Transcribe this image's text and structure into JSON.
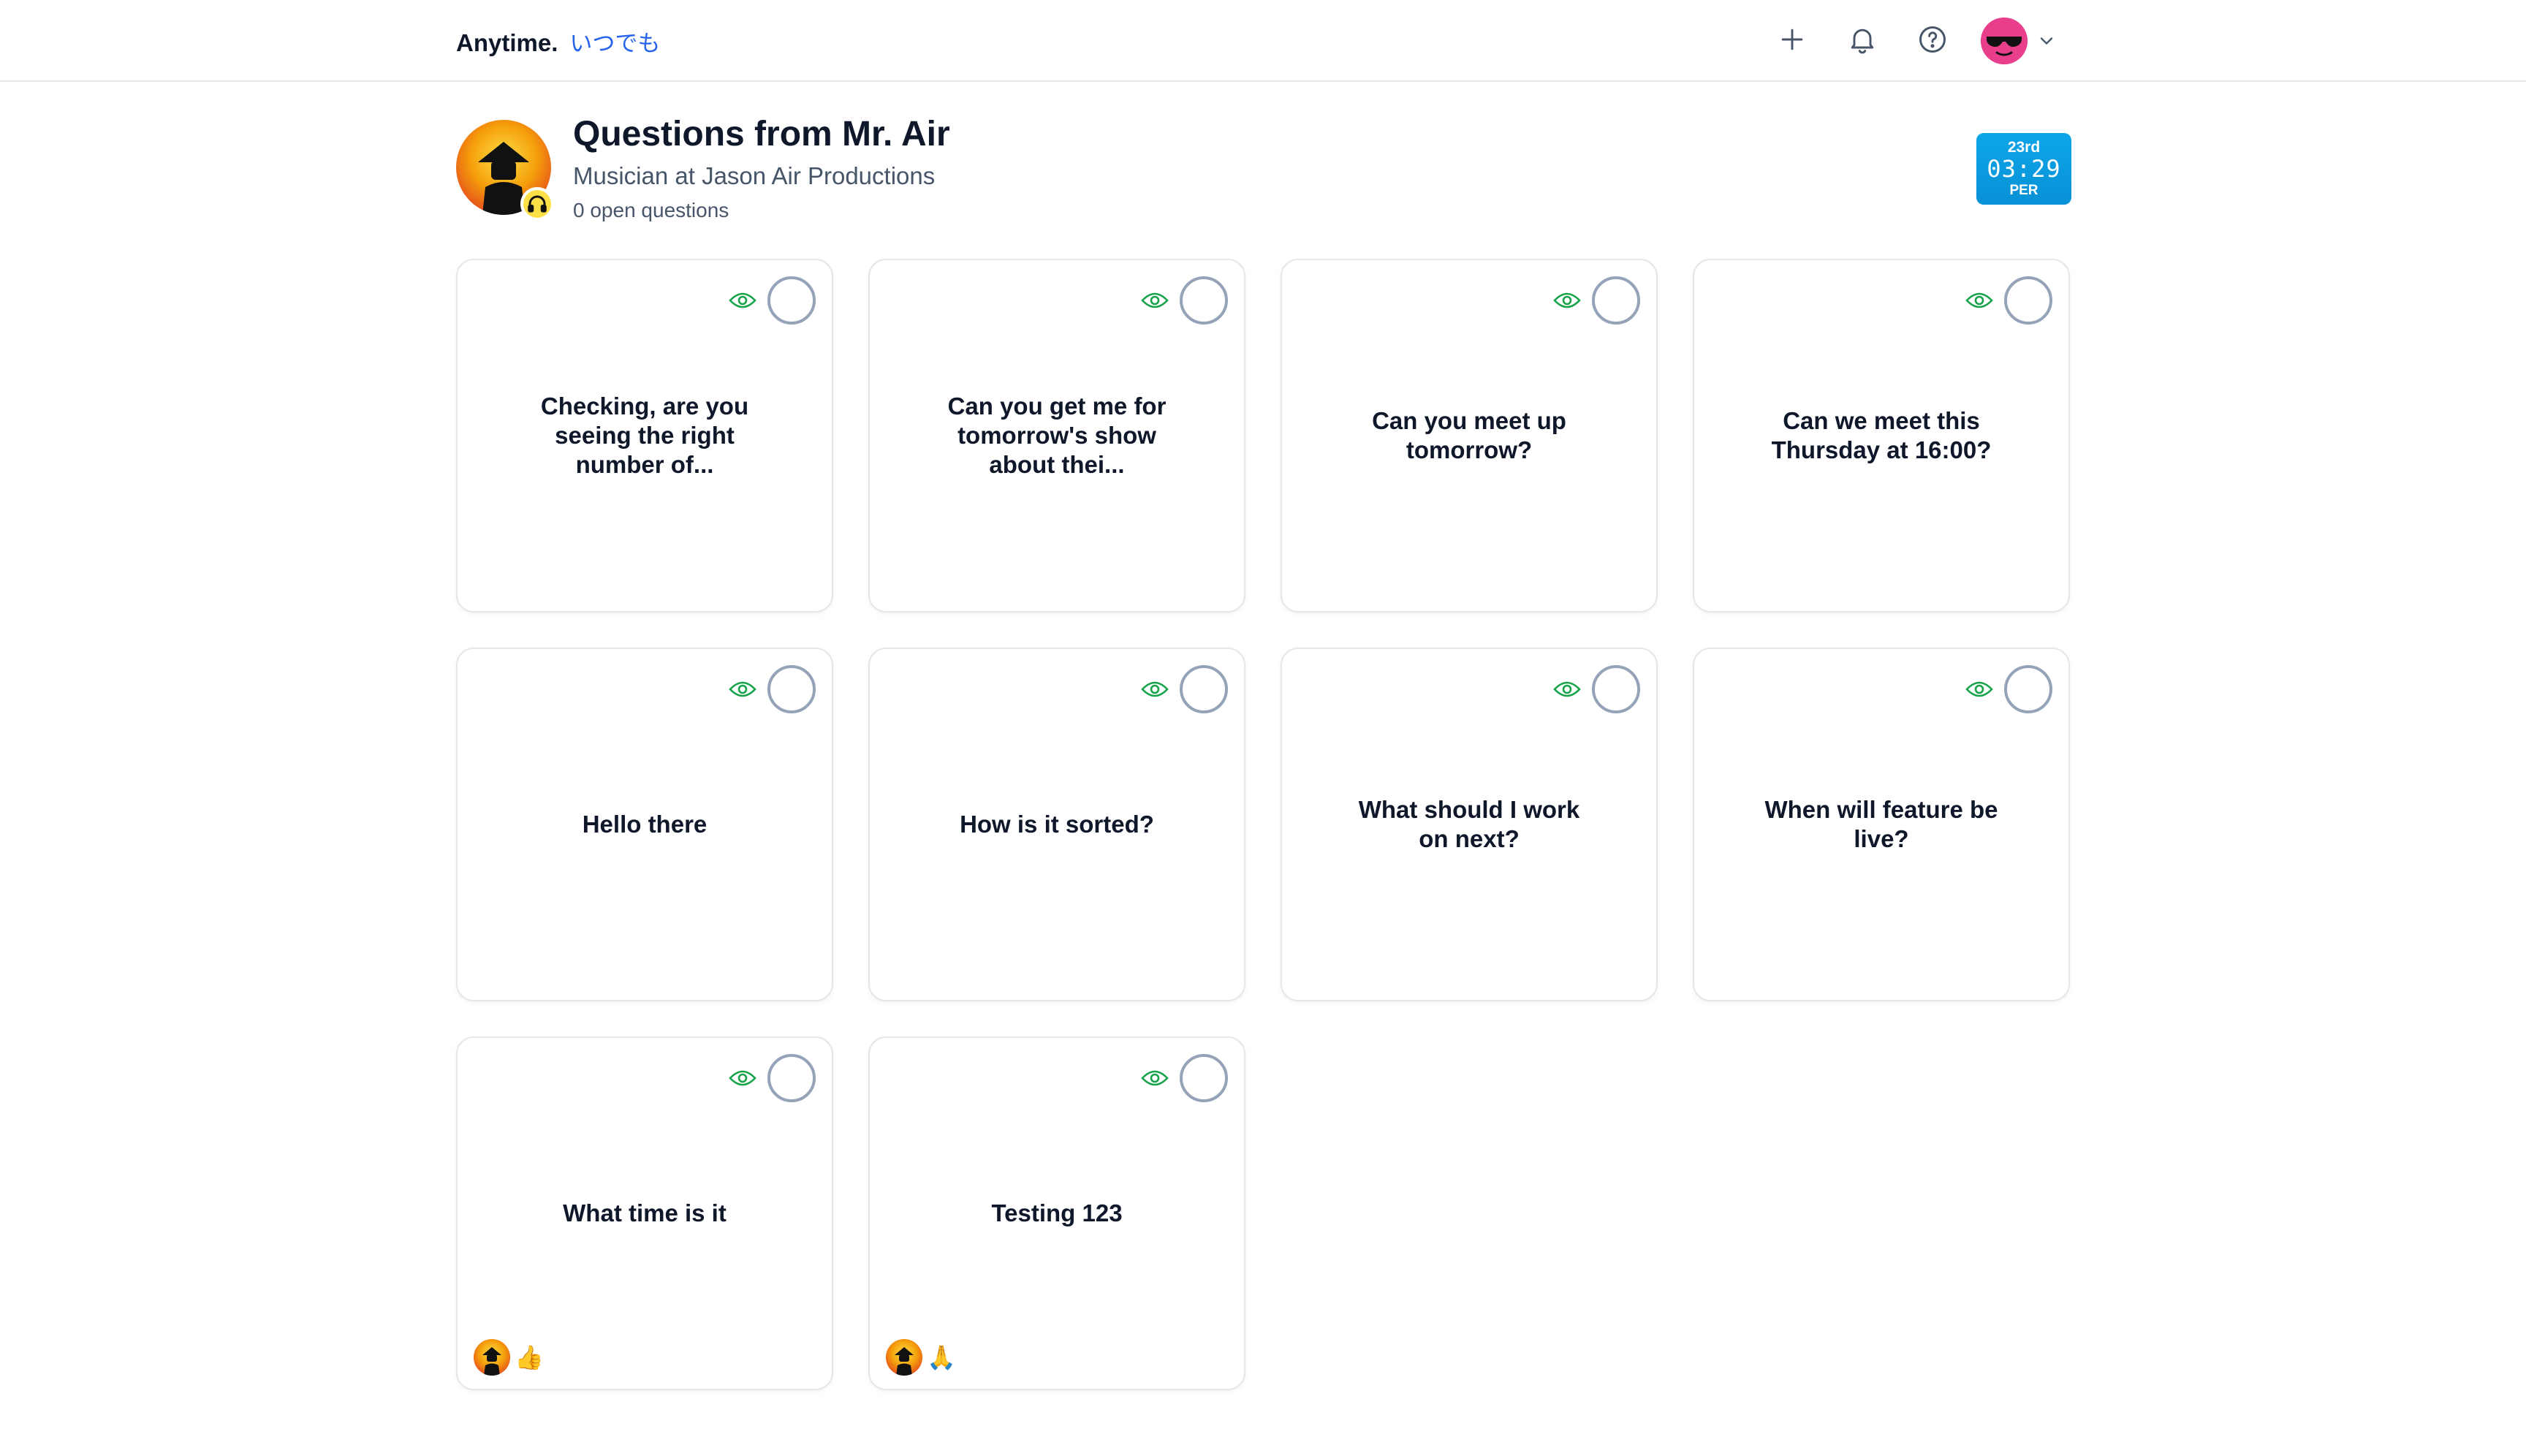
{
  "brand": {
    "name": "Anytime.",
    "jp": "いつでも"
  },
  "nav": {
    "icons": [
      "plus-icon",
      "bell-icon",
      "help-icon",
      "chevron-down-icon"
    ]
  },
  "header": {
    "title": "Questions from Mr. Air",
    "subtitle": "Musician at Jason Air Productions",
    "open_count": "0 open questions"
  },
  "clock": {
    "day": "23rd",
    "time": "03:29",
    "tz": "PER"
  },
  "colors": {
    "accent_blue": "#2563eb",
    "clock_bg": "#0ea5e9",
    "eye_green": "#16a34a",
    "avatar_pink": "#e83e8c"
  },
  "cards": [
    {
      "text": "Checking, are you seeing the right number of...",
      "reaction": ""
    },
    {
      "text": "Can you get me for tomorrow's show about thei...",
      "reaction": ""
    },
    {
      "text": "Can you meet up tomorrow?",
      "reaction": ""
    },
    {
      "text": "Can we meet this Thursday at 16:00?",
      "reaction": ""
    },
    {
      "text": "Hello there",
      "reaction": ""
    },
    {
      "text": "How is it sorted?",
      "reaction": ""
    },
    {
      "text": "What should I work on next?",
      "reaction": ""
    },
    {
      "text": "When will feature be live?",
      "reaction": ""
    },
    {
      "text": "What time is it",
      "reaction": "👍"
    },
    {
      "text": "Testing 123",
      "reaction": "🙏"
    }
  ]
}
